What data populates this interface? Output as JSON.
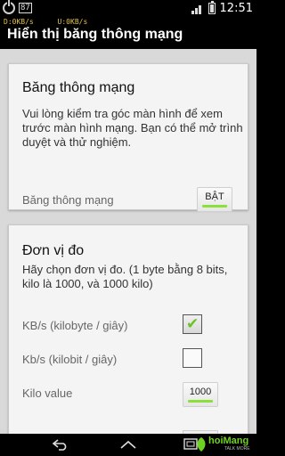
{
  "status_bar": {
    "badge": "87",
    "down_speed": "D:0KB/s",
    "up_speed": "U:0KB/s",
    "time": "12:51"
  },
  "title": "Hiển thị băng thông mạng",
  "bandwidth_card": {
    "title": "Băng thông mạng",
    "description": "Vui lòng kiểm tra góc màn hình để xem trước màn hình mạng. Bạn có thể mở trình duyệt và thử nghiệm.",
    "row_label": "Băng thông mạng",
    "toggle_label": "BẬT"
  },
  "unit_card": {
    "title": "Đơn vị đo",
    "description": "Hãy chọn đơn vị đo. (1 byte bằng 8 bits, kilo là 1000, và 1000 kilo)",
    "options": [
      {
        "label": "KB/s (kilobyte / giây)",
        "checked": true
      },
      {
        "label": "Kb/s (kilobit / giây)",
        "checked": false
      }
    ],
    "kilo_label": "Kilo value",
    "kilo_value": "1000"
  },
  "watermark": {
    "text": "hoiMang",
    "subtitle": "TALK MORE"
  },
  "colors": {
    "accent_green": "#8be13a",
    "speed_text": "#e3c24a",
    "check_green": "#6cc223"
  }
}
